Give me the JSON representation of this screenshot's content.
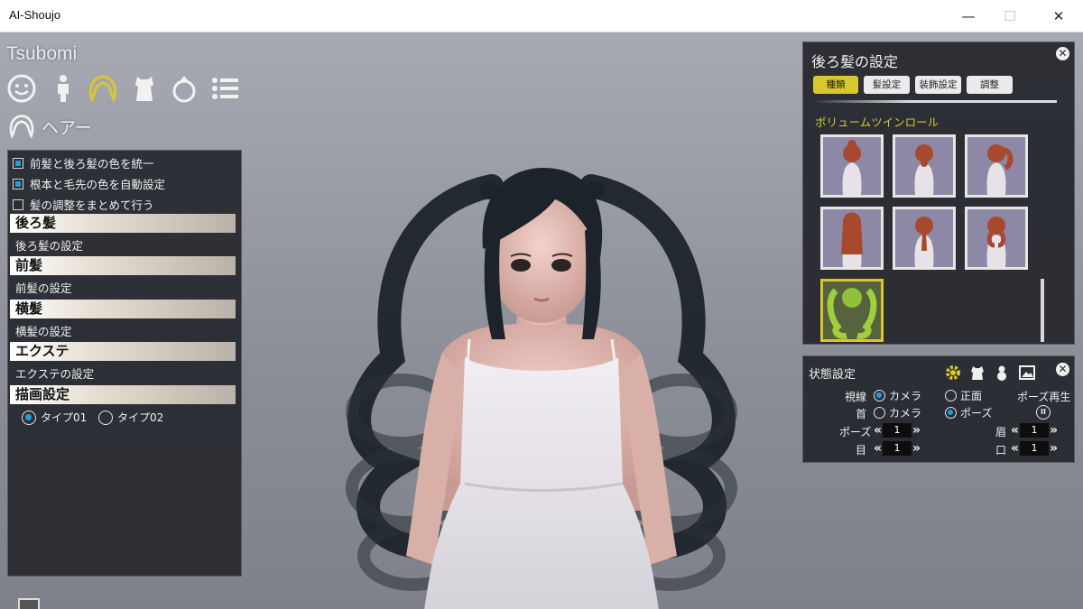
{
  "window": {
    "title": "AI-Shoujo",
    "minimize_glyph": "—",
    "maximize_glyph": "☐",
    "close_glyph": "✕"
  },
  "character": {
    "name": "Tsubomi"
  },
  "category_icons": [
    "face-icon",
    "body-icon",
    "hair-icon",
    "clothes-icon",
    "accessory-icon",
    "list-icon"
  ],
  "hair_section": {
    "label": "ヘアー",
    "icon": "hair-icon"
  },
  "left_panel": {
    "options": [
      {
        "label": "前髪と後ろ髪の色を統一",
        "checked": true
      },
      {
        "label": "根本と毛先の色を自動設定",
        "checked": true
      },
      {
        "label": "髪の調整をまとめて行う",
        "checked": false
      }
    ],
    "sections": [
      {
        "header": "後ろ髪",
        "item": "後ろ髪の設定"
      },
      {
        "header": "前髪",
        "item": "前髪の設定"
      },
      {
        "header": "横髪",
        "item": "横髪の設定"
      },
      {
        "header": "エクステ",
        "item": "エクステの設定"
      },
      {
        "header": "描画設定"
      }
    ],
    "render_types": [
      {
        "label": "タイプ01",
        "selected": true
      },
      {
        "label": "タイプ02",
        "selected": false
      }
    ]
  },
  "right_panel": {
    "title": "後ろ髪の設定",
    "close_glyph": "✕",
    "tabs": [
      {
        "label": "種類",
        "active": true
      },
      {
        "label": "髪設定",
        "active": false
      },
      {
        "label": "装飾設定",
        "active": false
      },
      {
        "label": "調整",
        "active": false
      }
    ],
    "selected_style": "ボリュームツインロール",
    "thumbnails": [
      {
        "name": "hairstyle-1",
        "selected": false
      },
      {
        "name": "hairstyle-2",
        "selected": false
      },
      {
        "name": "hairstyle-3",
        "selected": false
      },
      {
        "name": "hairstyle-4",
        "selected": false
      },
      {
        "name": "hairstyle-5",
        "selected": false
      },
      {
        "name": "hairstyle-6",
        "selected": false
      },
      {
        "name": "hairstyle-7",
        "selected": true
      }
    ]
  },
  "state_panel": {
    "title": "状態設定",
    "close_glyph": "✕",
    "icons": [
      "gear-icon",
      "outfit-icon",
      "snowman-icon",
      "picture-icon"
    ],
    "gaze": {
      "label": "視線",
      "options": [
        {
          "label": "カメラ",
          "selected": true
        },
        {
          "label": "正面",
          "selected": false
        }
      ]
    },
    "neck": {
      "label": "首",
      "options": [
        {
          "label": "カメラ",
          "selected": false
        },
        {
          "label": "ポーズ",
          "selected": true
        }
      ]
    },
    "pose_play": {
      "label": "ポーズ再生",
      "glyph": "II"
    },
    "steppers": [
      {
        "label": "ポーズ",
        "value": "1"
      },
      {
        "label": "眉",
        "value": "1"
      },
      {
        "label": "目",
        "value": "1"
      },
      {
        "label": "口",
        "value": "1"
      }
    ]
  },
  "colors": {
    "accent": "#d7c82e",
    "checkbox_on": "#1e9ee6",
    "panel_bg": "#28292e",
    "hair": "#1c232a"
  }
}
